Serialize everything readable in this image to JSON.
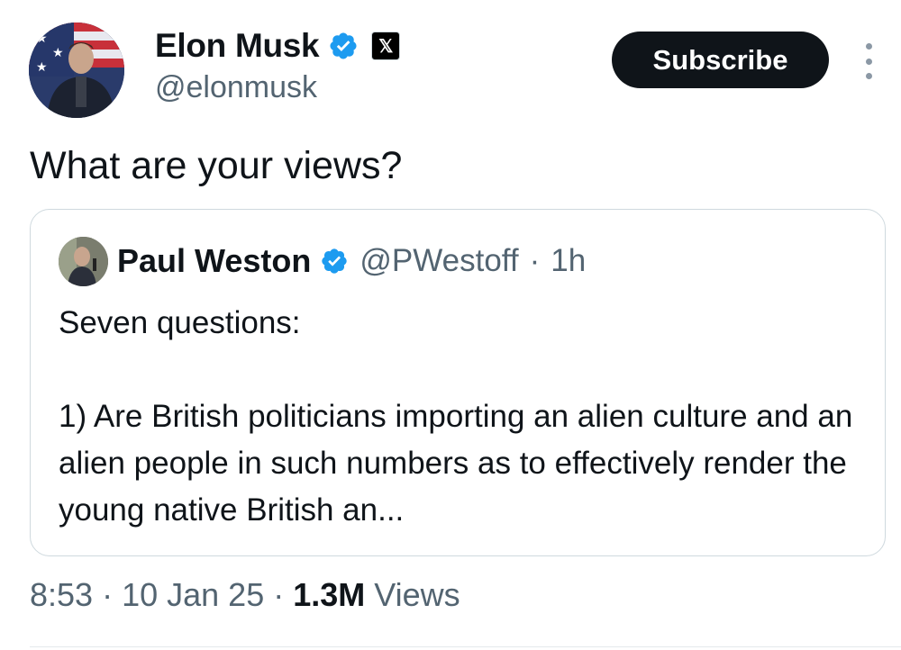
{
  "author": {
    "name": "Elon Musk",
    "handle": "@elonmusk",
    "badge_x": "𝕏"
  },
  "subscribe_label": "Subscribe",
  "tweet_text": "What are your views?",
  "quoted": {
    "name": "Paul Weston",
    "handle": "@PWestoff",
    "separator": "·",
    "time": "1h",
    "text": "Seven questions:\n\n1) Are British politicians importing an alien culture and an alien people in such numbers as to effectively render the young native British an..."
  },
  "meta": {
    "time": "8:53",
    "sep1": " · ",
    "date": "10 Jan 25",
    "sep2": " · ",
    "views_count": "1.3M",
    "views_label": " Views"
  },
  "colors": {
    "verified": "#1d9bf0",
    "text": "#0f1419",
    "secondary": "#536471",
    "border": "#cfd9de"
  }
}
